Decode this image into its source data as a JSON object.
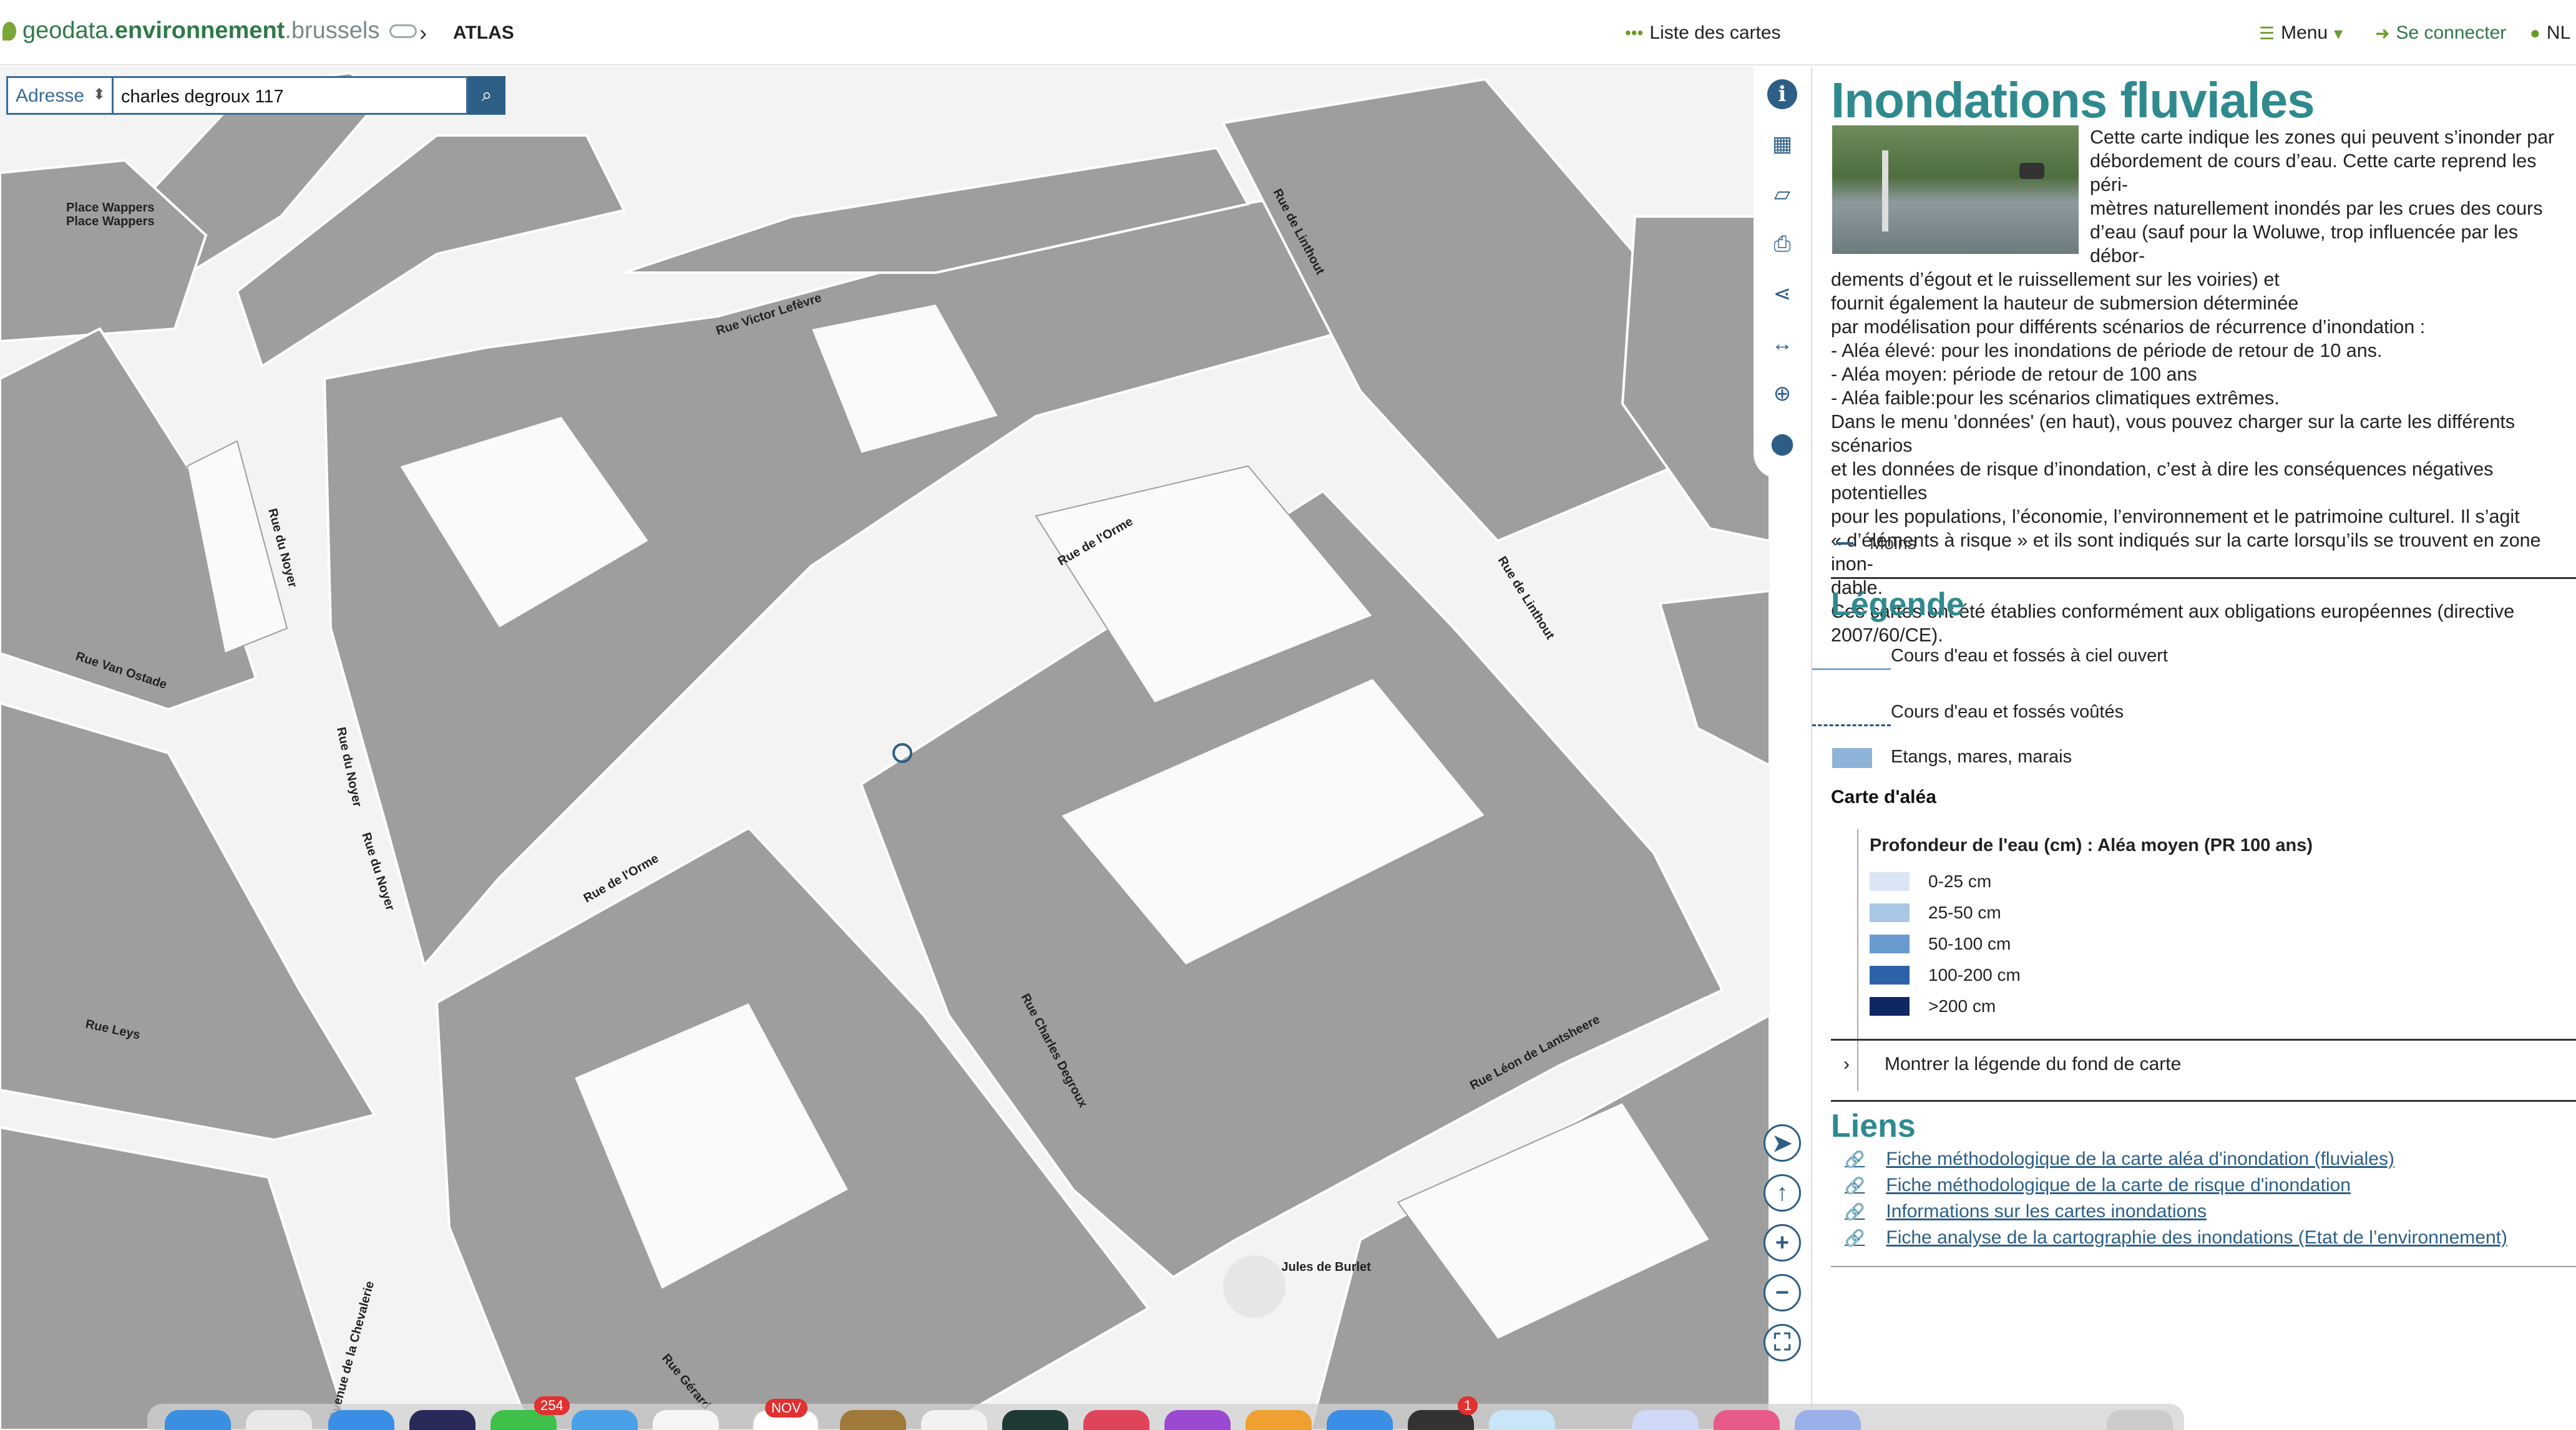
{
  "header": {
    "logo_part1": "geodata.",
    "logo_part2": "environnement",
    "logo_part3": ".brussels",
    "breadcrumb_sep": "›",
    "breadcrumb": "ATLAS",
    "list_maps": "Liste des cartes",
    "menu": "Menu",
    "login": "Se connecter",
    "lang": "NL"
  },
  "search": {
    "type": "Adresse",
    "value": "charles degroux 117"
  },
  "map": {
    "labels": [
      "Place Wappers",
      "Place Wappers",
      "Rue Victor Lefèvre",
      "Rue de Linthout",
      "Rue du Noyer",
      "Rue Van Ostade",
      "Rue du Noyer",
      "Rue du Noyer",
      "Rue de l'Orme",
      "Rue de l'Orme",
      "Rue Leys",
      "Rue Charles Degroux",
      "Rue de Linthout",
      "Rue Léon de Lantsheere",
      "Square Jules de Burlet",
      "Rue Gérard",
      "Avenue de la Chevalerie"
    ]
  },
  "sidebar": {
    "title": "Inondations fluviales",
    "description_lines": [
      "Cette carte indique les zones qui peuvent s’inonder par",
      "débordement de cours d’eau. Cette carte reprend les péri-",
      "mètres naturellement inondés par les crues des cours",
      "d’eau (sauf pour la Woluwe, trop influencée par les débor-",
      "dements d’égout et le ruissellement sur les voiries) et",
      "fournit également la hauteur de submersion déterminée",
      "par modélisation pour différents scénarios de récurrence d’inondation :",
      "- Aléa élevé: pour les inondations de période de retour de 10 ans.",
      "- Aléa moyen: période de retour de 100 ans",
      "- Aléa faible:pour les scénarios climatiques extrêmes.",
      "Dans le menu 'données' (en haut), vous pouvez charger sur la carte les différents scénarios",
      "et les données de risque d’inondation, c’est à dire les conséquences négatives potentielles",
      "pour les populations, l’économie, l’environnement et le patrimoine culturel. Il s’agit",
      "« d’éléments à risque » et ils sont indiqués sur la carte lorsqu’ils se trouvent en zone inon-",
      "dable.",
      "Ces cartes ont été établies conformément aux obligations européennes (directive",
      "2007/60/CE)."
    ],
    "less": "Moins",
    "legend_title": "Légende",
    "legend_items": [
      "Cours d'eau et fossés à ciel ouvert",
      "Cours d'eau et fossés voûtés",
      "Etangs, mares, marais"
    ],
    "hazard_map": "Carte d'aléa",
    "depth_title": "Profondeur de l'eau (cm) : Aléa moyen (PR 100 ans)",
    "depth_classes": [
      {
        "label": "0-25 cm",
        "color": "#dbe6f4"
      },
      {
        "label": "25-50 cm",
        "color": "#a9c6e4"
      },
      {
        "label": "50-100 cm",
        "color": "#6a9bd0"
      },
      {
        "label": "100-200 cm",
        "color": "#2d62a8"
      },
      {
        "label": ">200 cm",
        "color": "#0f2763"
      }
    ],
    "show_basemap_legend": "Montrer la légende du fond de carte",
    "links_title": "Liens",
    "links": [
      "Fiche méthodologique de la carte aléa d'inondation (fluviales)",
      "Fiche méthodologique de la carte de risque d'inondation",
      "Informations sur les cartes inondations",
      "Fiche analyse de la cartographie des inondations (Etat de l’environnement)"
    ]
  },
  "dock": {
    "badge_messages": "254",
    "badge_calendar": "NOV",
    "badge_other": "1"
  }
}
